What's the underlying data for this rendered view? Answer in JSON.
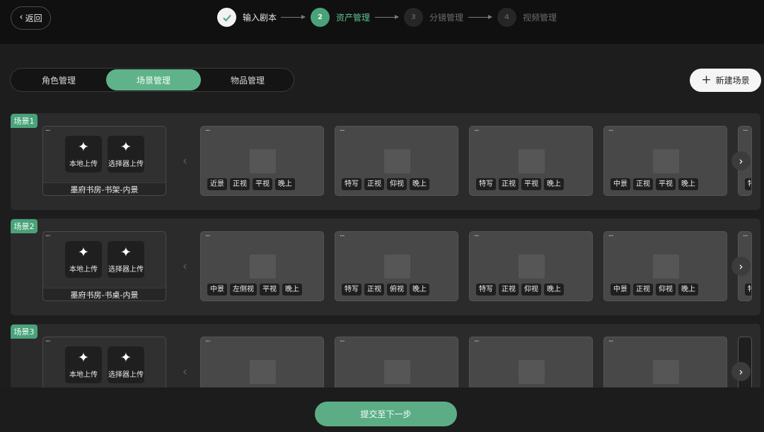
{
  "header": {
    "back_label": "返回",
    "steps": [
      {
        "number": "",
        "label": "输入剧本",
        "state": "done"
      },
      {
        "number": "2",
        "label": "资产管理",
        "state": "active"
      },
      {
        "number": "3",
        "label": "分镜管理",
        "state": "idle"
      },
      {
        "number": "4",
        "label": "视频管理",
        "state": "idle"
      }
    ]
  },
  "tabs": [
    {
      "label": "角色管理",
      "active": false
    },
    {
      "label": "场景管理",
      "active": true
    },
    {
      "label": "物品管理",
      "active": false
    }
  ],
  "new_button_label": "新建场景",
  "scenes": [
    {
      "badge": "场景1",
      "name": "墨府书房-书架-内景",
      "upload_local": "本地上传",
      "upload_selector": "选择器上传",
      "cards": [
        {
          "tags": [
            "近景",
            "正视",
            "平视",
            "晚上"
          ]
        },
        {
          "tags": [
            "特写",
            "正视",
            "仰视",
            "晚上"
          ]
        },
        {
          "tags": [
            "特写",
            "正视",
            "平视",
            "晚上"
          ]
        },
        {
          "tags": [
            "中景",
            "正视",
            "平视",
            "晚上"
          ]
        }
      ],
      "partial_tag": "特"
    },
    {
      "badge": "场景2",
      "name": "墨府书房-书桌-内景",
      "upload_local": "本地上传",
      "upload_selector": "选择器上传",
      "cards": [
        {
          "tags": [
            "中景",
            "左侧视",
            "平视",
            "晚上"
          ]
        },
        {
          "tags": [
            "特写",
            "正视",
            "俯视",
            "晚上"
          ]
        },
        {
          "tags": [
            "特写",
            "正视",
            "仰视",
            "晚上"
          ]
        },
        {
          "tags": [
            "中景",
            "正视",
            "仰视",
            "晚上"
          ]
        }
      ],
      "partial_tag": "特"
    },
    {
      "badge": "场景3",
      "name": "",
      "upload_local": "本地上传",
      "upload_selector": "选择器上传",
      "cards": [
        {
          "tags": []
        },
        {
          "tags": []
        },
        {
          "tags": []
        },
        {
          "tags": []
        }
      ],
      "partial_tag": ""
    }
  ],
  "submit_label": "提交至下一步",
  "icons": {
    "back": "chevron-left-icon",
    "done": "check-icon",
    "add": "plus-icon",
    "upload": "sparkle-icon",
    "more": "more-icon",
    "prev": "chevron-left-icon",
    "next": "chevron-right-icon"
  },
  "colors": {
    "accent": "#4aa27a",
    "background": "#1d1d1d",
    "card": "#484848"
  }
}
